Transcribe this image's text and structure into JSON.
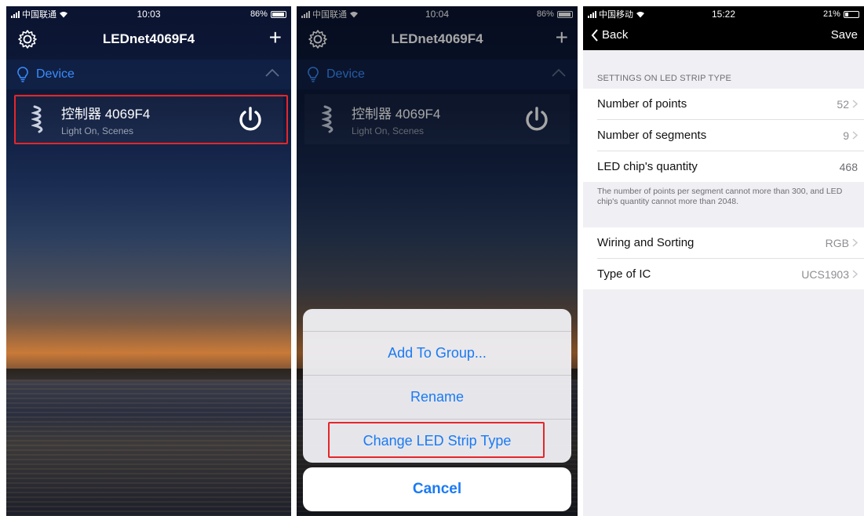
{
  "screen1": {
    "status": {
      "carrier": "中国联通",
      "time": "10:03",
      "battery": "86%"
    },
    "title": "LEDnet4069F4",
    "section": "Device",
    "device": {
      "name": "控制器 4069F4",
      "status": "Light On, Scenes"
    },
    "colors": {
      "accent": "#3a8cff",
      "highlight": "#e5262a"
    }
  },
  "screen2": {
    "status": {
      "carrier": "中国联通",
      "time": "10:04",
      "battery": "86%"
    },
    "title": "LEDnet4069F4",
    "section": "Device",
    "device": {
      "name": "控制器 4069F4",
      "status": "Light On, Scenes"
    },
    "sheet": {
      "options": [
        "Add To Group...",
        "Rename",
        "Change LED Strip Type"
      ],
      "cancel": "Cancel"
    }
  },
  "screen3": {
    "status": {
      "carrier": "中国移动",
      "time": "15:22",
      "battery": "21%"
    },
    "nav": {
      "back": "Back",
      "save": "Save"
    },
    "caption": "SETTINGS ON LED STRIP TYPE",
    "rows1": [
      {
        "label": "Number of points",
        "value": "52"
      },
      {
        "label": "Number of segments",
        "value": "9"
      },
      {
        "label": "LED chip's quantity",
        "value": "468"
      }
    ],
    "note": "The number of points per segment cannot more than 300, and LED chip's quantity cannot  more than 2048.",
    "rows2": [
      {
        "label": "Wiring and Sorting",
        "value": "RGB"
      },
      {
        "label": "Type of IC",
        "value": "UCS1903"
      }
    ]
  },
  "icons": [
    "signal-icon",
    "wifi-icon",
    "battery-icon",
    "gear-icon",
    "plus-icon",
    "bulb-icon",
    "chevron-up-icon",
    "led-strip-icon",
    "power-icon",
    "back-chevron-icon",
    "chevron-right-icon"
  ]
}
